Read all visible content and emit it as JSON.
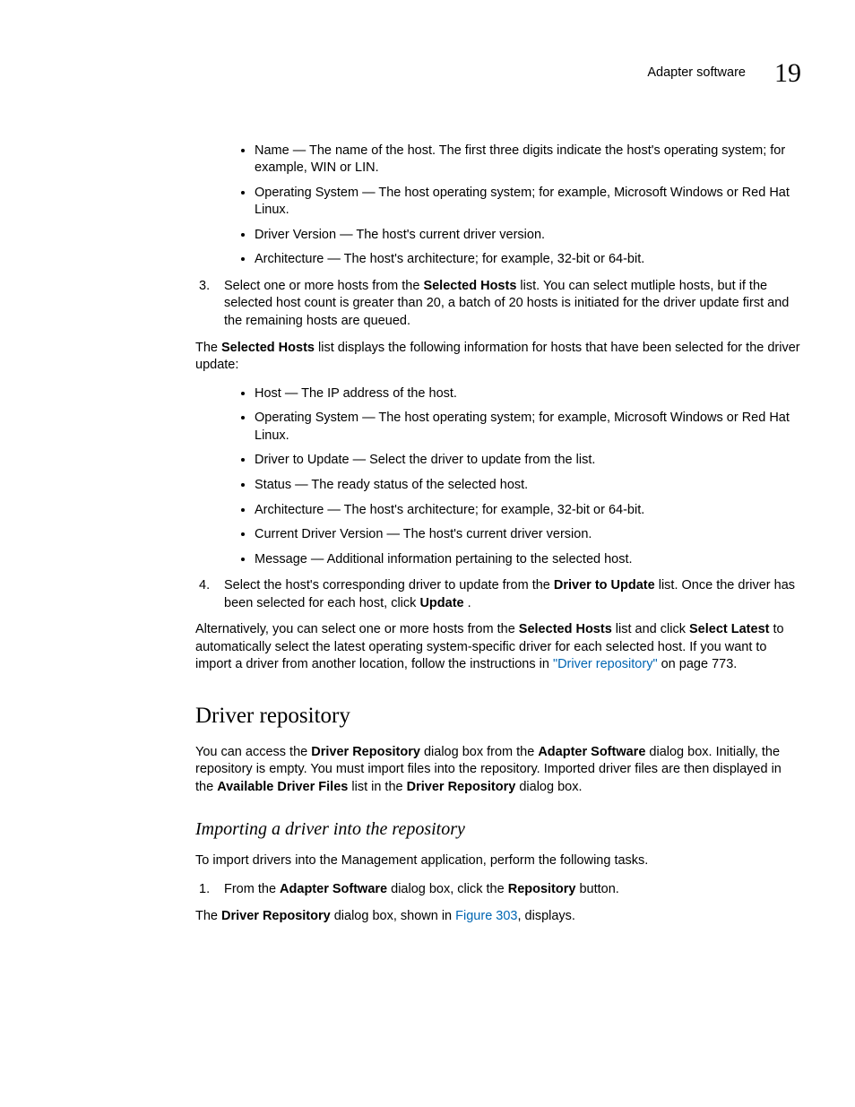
{
  "header": {
    "title": "Adapter software",
    "chapter": "19"
  },
  "top_bullets": [
    "Name — The name of the host. The first three digits indicate the host's operating system; for example, WIN or LIN.",
    "Operating System — The host operating system; for example, Microsoft Windows or Red Hat Linux.",
    "Driver Version — The host's current driver version.",
    "Architecture — The host's architecture; for example, 32-bit or 64-bit."
  ],
  "step3": {
    "num": "3.",
    "lead_a": "Select one or more hosts from the ",
    "bold_a": "Selected Hosts",
    "lead_b": " list. You can select mutliple hosts, but if the selected host count is greater than 20, a batch of 20 hosts is initiated for the driver update first and the remaining hosts are queued.",
    "p2_a": "The ",
    "p2_bold": "Selected Hosts",
    "p2_b": " list displays the following information for hosts that have been selected for the driver update:",
    "bullets": [
      "Host — The IP address of the host.",
      "Operating System — The host operating system; for example, Microsoft Windows or Red Hat Linux.",
      "Driver to Update — Select the driver to update from the list.",
      "Status — The ready status of the selected host.",
      "Architecture — The host's architecture; for example, 32-bit or 64-bit.",
      "Current Driver Version — The host's current driver version.",
      "Message — Additional information pertaining to the selected host."
    ]
  },
  "step4": {
    "num": "4.",
    "a": "Select the host's corresponding driver to update from the ",
    "b_bold": "Driver to Update",
    "c": " list. Once the driver has been selected for each host, click ",
    "d_bold": "Update ",
    "e": ".",
    "p2_a": "Alternatively, you can select one or more hosts from the ",
    "p2_b_bold": "Selected Hosts",
    "p2_c": " list and click ",
    "p2_d_bold": "Select Latest",
    "p2_e": " to automatically select the latest operating system-specific driver for each selected host. If you want to import a driver from another location, follow the instructions in ",
    "p2_link": "\"Driver repository\"",
    "p2_f": " on page 773."
  },
  "section": {
    "heading": "Driver repository",
    "p1_a": "You can access the ",
    "p1_b_bold": "Driver Repository",
    "p1_c": " dialog box from the ",
    "p1_d_bold": "Adapter Software",
    "p1_e": " dialog box. Initially, the repository is empty. You must import files into the repository. Imported driver files are then displayed in the ",
    "p1_f_bold": "Available Driver Files",
    "p1_g": " list in the ",
    "p1_h_bold": "Driver Repository",
    "p1_i": " dialog box."
  },
  "sub": {
    "heading": "Importing a driver into the repository",
    "p1": "To import drivers into the Management application, perform the following tasks.",
    "step1": {
      "num": "1.",
      "a": "From the ",
      "b_bold": "Adapter Software",
      "c": " dialog box, click the ",
      "d_bold": "Repository",
      "e": " button."
    },
    "step1_p2_a": "The ",
    "step1_p2_b_bold": "Driver Repository",
    "step1_p2_c": " dialog box, shown in ",
    "step1_p2_link": "Figure 303",
    "step1_p2_d": ", displays."
  }
}
